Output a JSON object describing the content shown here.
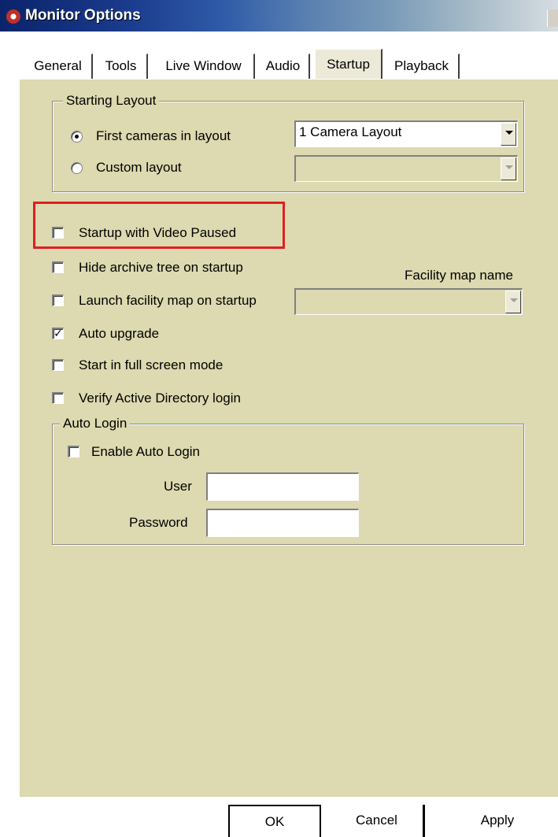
{
  "window": {
    "title": "Monitor Options"
  },
  "tabs": [
    {
      "label": "General"
    },
    {
      "label": "Tools"
    },
    {
      "label": "Live Window"
    },
    {
      "label": "Audio"
    },
    {
      "label": "Startup",
      "active": true
    },
    {
      "label": "Playback"
    }
  ],
  "starting_layout": {
    "group_label": "Starting Layout",
    "first_cameras_label": "First cameras in layout",
    "first_cameras_selected": true,
    "layout_combo_value": "1 Camera Layout",
    "custom_layout_label": "Custom layout",
    "custom_layout_selected": false,
    "custom_combo_value": ""
  },
  "options": {
    "startup_video_paused": {
      "label": "Startup with Video Paused",
      "checked": false
    },
    "hide_archive_tree": {
      "label": "Hide archive tree on startup",
      "checked": false
    },
    "launch_facility_map": {
      "label": "Launch facility map on startup",
      "checked": false
    },
    "facility_map_name_label": "Facility map name",
    "facility_map_value": "",
    "auto_upgrade": {
      "label": "Auto upgrade",
      "checked": true
    },
    "full_screen": {
      "label": "Start in full screen mode",
      "checked": false
    },
    "verify_ad_login": {
      "label": "Verify Active Directory login",
      "checked": false
    }
  },
  "auto_login": {
    "group_label": "Auto Login",
    "enable_label": "Enable Auto Login",
    "enable_checked": false,
    "user_label": "User",
    "user_value": "",
    "password_label": "Password",
    "password_value": ""
  },
  "buttons": {
    "ok": "OK",
    "cancel": "Cancel",
    "apply": "Apply"
  },
  "colors": {
    "panel_bg": "#ddd9b0",
    "highlight": "#e02020",
    "titlebar": "#0a246a"
  }
}
